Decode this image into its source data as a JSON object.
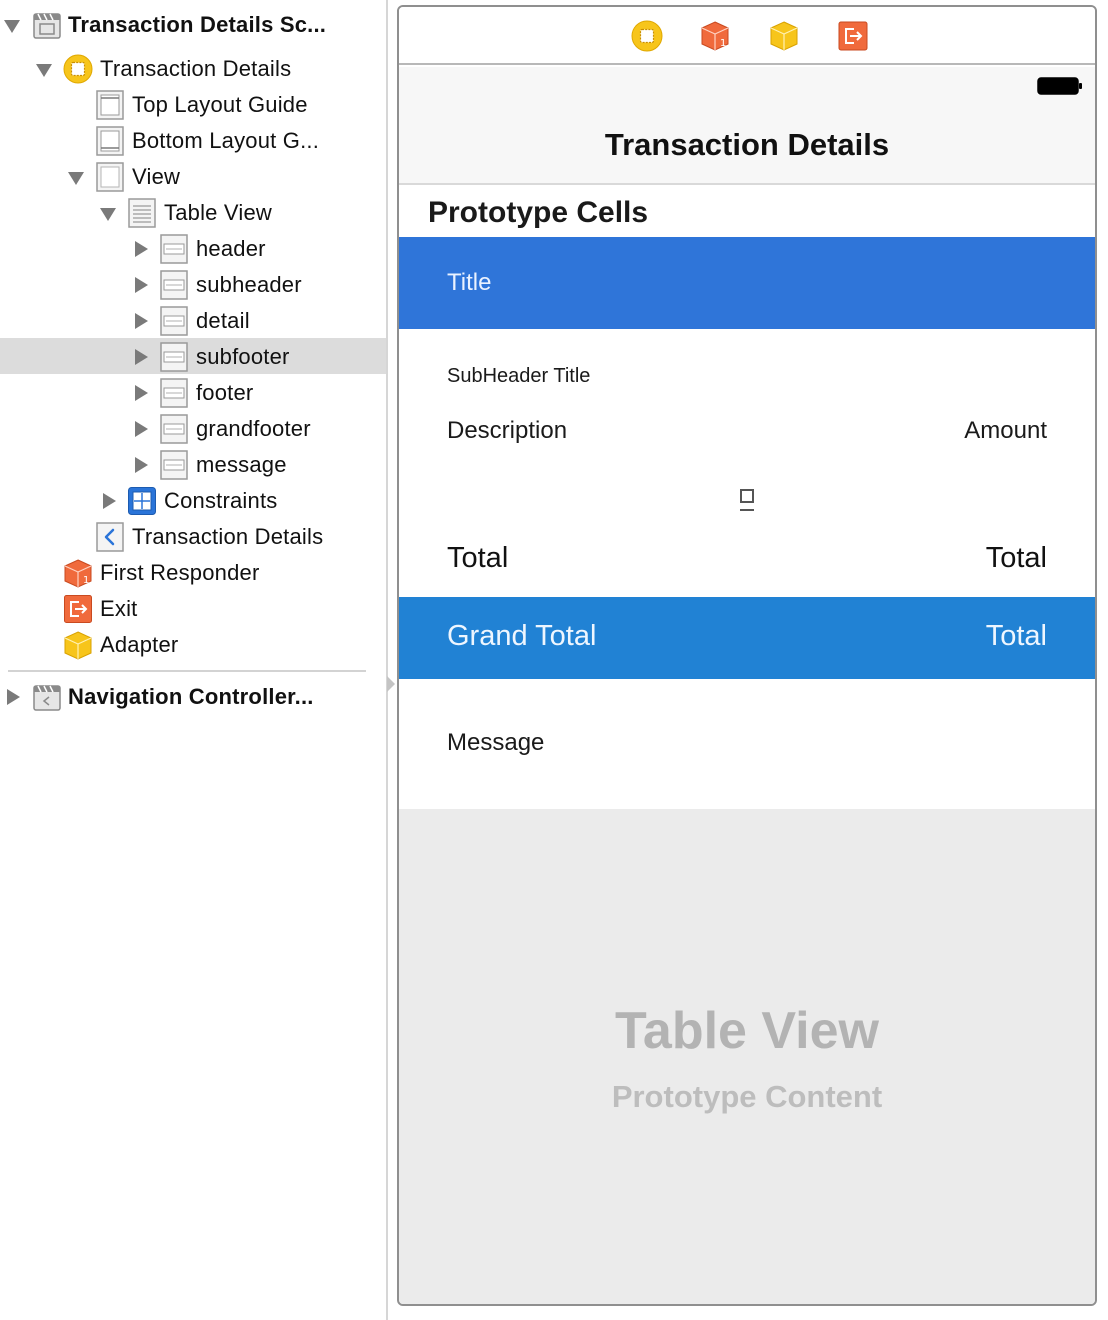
{
  "outline": {
    "items": [
      {
        "label": "Transaction Details Sc...",
        "icon": "storyboard-scene-icon",
        "disclosure": "open",
        "bold": true
      },
      {
        "label": "Transaction Details",
        "icon": "view-controller-icon",
        "disclosure": "open",
        "bold": false
      },
      {
        "label": "Top Layout Guide",
        "icon": "layout-guide-icon",
        "disclosure": "none",
        "bold": false
      },
      {
        "label": "Bottom Layout G...",
        "icon": "layout-guide-icon",
        "disclosure": "none",
        "bold": false
      },
      {
        "label": "View",
        "icon": "view-icon",
        "disclosure": "open",
        "bold": false
      },
      {
        "label": "Table View",
        "icon": "table-view-icon",
        "disclosure": "open",
        "bold": false
      },
      {
        "label": "header",
        "icon": "table-cell-icon",
        "disclosure": "closed",
        "bold": false
      },
      {
        "label": "subheader",
        "icon": "table-cell-icon",
        "disclosure": "closed",
        "bold": false
      },
      {
        "label": "detail",
        "icon": "table-cell-icon",
        "disclosure": "closed",
        "bold": false
      },
      {
        "label": "subfooter",
        "icon": "table-cell-icon",
        "disclosure": "closed",
        "bold": false,
        "selected": true
      },
      {
        "label": "footer",
        "icon": "table-cell-icon",
        "disclosure": "closed",
        "bold": false
      },
      {
        "label": "grandfooter",
        "icon": "table-cell-icon",
        "disclosure": "closed",
        "bold": false
      },
      {
        "label": "message",
        "icon": "table-cell-icon",
        "disclosure": "closed",
        "bold": false
      },
      {
        "label": "Constraints",
        "icon": "constraints-icon",
        "disclosure": "closed",
        "bold": false
      },
      {
        "label": "Transaction Details",
        "icon": "navigation-item-icon",
        "disclosure": "none",
        "bold": false
      },
      {
        "label": "First Responder",
        "icon": "first-responder-icon",
        "disclosure": "none",
        "bold": false
      },
      {
        "label": "Exit",
        "icon": "exit-icon",
        "disclosure": "none",
        "bold": false
      },
      {
        "label": "Adapter",
        "icon": "object-icon",
        "disclosure": "none",
        "bold": false
      }
    ],
    "second_scene": {
      "label": "Navigation Controller...",
      "icon": "storyboard-scene-icon",
      "disclosure": "closed",
      "bold": true
    }
  },
  "scene": {
    "dock_icons": [
      "view-controller-icon",
      "first-responder-icon",
      "object-icon",
      "exit-icon"
    ],
    "nav_title": "Transaction Details",
    "section_title": "Prototype Cells",
    "cells": {
      "title": "Title",
      "subheader": "SubHeader Title",
      "detail_description": "Description",
      "detail_amount": "Amount",
      "footer_left": "Total",
      "footer_right": "Total",
      "grandfooter_left": "Grand Total",
      "grandfooter_right": "Total",
      "message": "Message"
    },
    "placeholder_title": "Table View",
    "placeholder_subtitle": "Prototype Content"
  },
  "colors": {
    "selection": "#dcdcdc",
    "title_cell": "#2f75d9",
    "grandfooter_cell": "#2182d4",
    "icon_yellow": "#f7c51b",
    "icon_orange": "#f06a3c",
    "icon_blue": "#2a74d8"
  }
}
